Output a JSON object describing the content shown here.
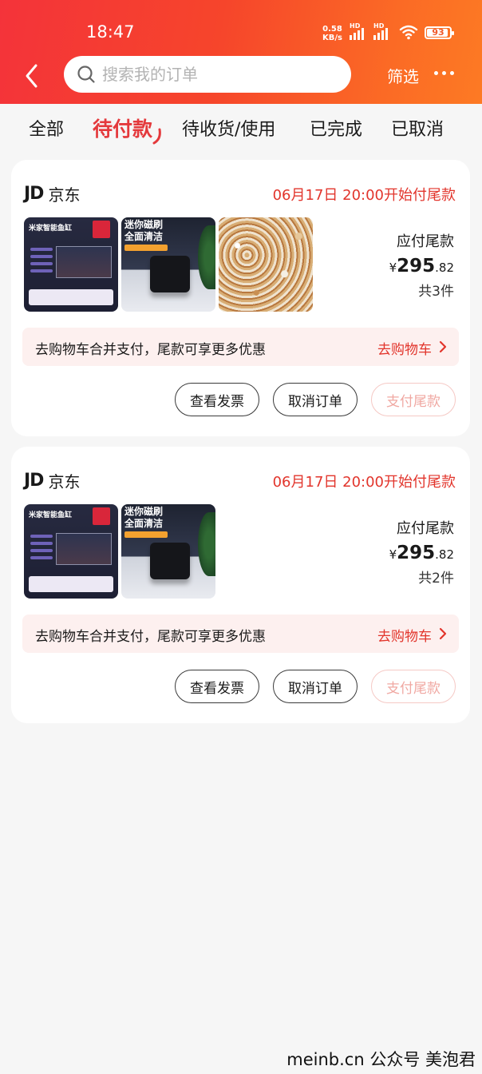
{
  "status_bar": {
    "time": "18:47",
    "net_speed_value": "0.58",
    "net_speed_unit": "KB/s",
    "signal_tag": "HD",
    "battery": "93"
  },
  "header": {
    "search_placeholder": "搜索我的订单",
    "filter_label": "筛选",
    "icons": [
      "back-arrow-icon",
      "search-icon",
      "more-icon"
    ]
  },
  "tabs": [
    {
      "label": "全部",
      "active": false
    },
    {
      "label": "待付款",
      "active": true
    },
    {
      "label": "待收货/使用",
      "active": false
    },
    {
      "label": "已完成",
      "active": false
    },
    {
      "label": "已取消",
      "active": false
    }
  ],
  "orders": [
    {
      "shop_logo": "JD",
      "shop_name": "京东",
      "status": "06月17日 20:00开始付尾款",
      "products": [
        {
          "kind": "fish-tank",
          "text": "米家智能鱼缸"
        },
        {
          "kind": "magnetic-brush",
          "text": "迷你磁刷\n全面清洁"
        },
        {
          "kind": "aquarium-sand"
        }
      ],
      "pay_label": "应付尾款",
      "currency": "¥",
      "amount_int": "295",
      "amount_dec": ".82",
      "count": "共3件",
      "promo_text": "去购物车合并支付，尾款可享更多优惠",
      "promo_link": "去购物车",
      "buttons": {
        "invoice": "查看发票",
        "cancel": "取消订单",
        "pay": "支付尾款"
      }
    },
    {
      "shop_logo": "JD",
      "shop_name": "京东",
      "status": "06月17日 20:00开始付尾款",
      "products": [
        {
          "kind": "fish-tank",
          "text": "米家智能鱼缸"
        },
        {
          "kind": "magnetic-brush",
          "text": "迷你磁刷\n全面清洁"
        }
      ],
      "pay_label": "应付尾款",
      "currency": "¥",
      "amount_int": "295",
      "amount_dec": ".82",
      "count": "共2件",
      "promo_text": "去购物车合并支付，尾款可享更多优惠",
      "promo_link": "去购物车",
      "buttons": {
        "invoice": "查看发票",
        "cancel": "取消订单",
        "pay": "支付尾款"
      }
    }
  ],
  "watermark": "meinb.cn 公众号 美泡君",
  "colors": {
    "accent": "#e4393c",
    "header_start": "#f4333a",
    "header_end": "#fd7a24",
    "promo_bg": "#fdf0ef"
  }
}
